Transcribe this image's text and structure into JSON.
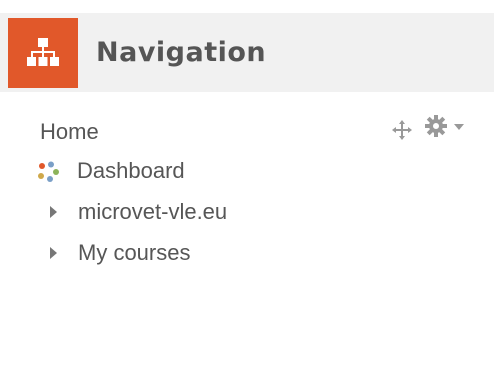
{
  "block": {
    "title": "Navigation",
    "icon": "sitemap-icon",
    "accent_color": "#e1582a"
  },
  "nav": {
    "items": [
      {
        "label": "Home",
        "icon": null
      },
      {
        "label": "Dashboard",
        "icon": "dashboard-icon"
      },
      {
        "label": "microvet-vle.eu",
        "icon": "expand-arrow-icon"
      },
      {
        "label": "My courses",
        "icon": "expand-arrow-icon"
      }
    ]
  },
  "controls": {
    "move": "move-icon",
    "actions": "gear-icon",
    "menu": "chevron-down-icon"
  }
}
